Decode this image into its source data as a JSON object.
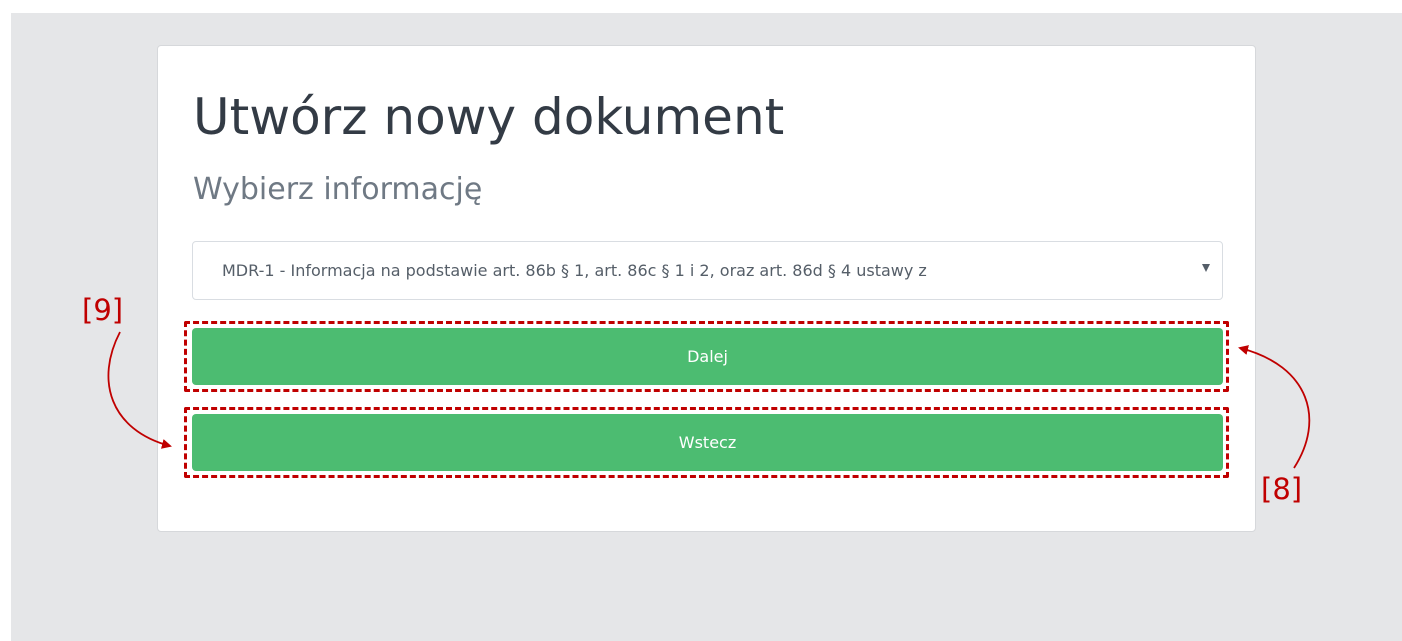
{
  "page": {
    "title": "Utwórz nowy dokument",
    "subtitle": "Wybierz informację"
  },
  "form": {
    "select_value": "MDR-1 - Informacja na podstawie art. 86b § 1, art. 86c § 1 i 2, oraz art. 86d § 4 ustawy z",
    "next_label": "Dalej",
    "back_label": "Wstecz"
  },
  "annotations": {
    "callout_back": "[9]",
    "callout_next": "[8]"
  },
  "colors": {
    "background": "#e5e6e8",
    "button": "#4cbc71",
    "annotation": "#c00000"
  },
  "icons": {
    "select_caret": "caret-down-icon",
    "callout_arrow": "curved-arrow-icon"
  }
}
